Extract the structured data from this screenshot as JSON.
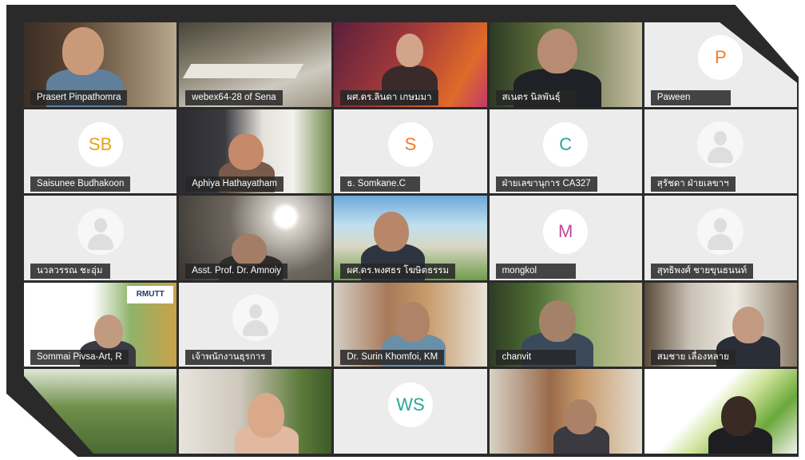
{
  "participants": [
    {
      "name": "Prasert Pinpathomra",
      "kind": "video"
    },
    {
      "name": "webex64-28 of  Sena",
      "kind": "video"
    },
    {
      "name": "ผศ.ดร.ลินดา เกษมมา",
      "kind": "video"
    },
    {
      "name": "สเนตร นิลพันธุ์",
      "kind": "video"
    },
    {
      "name": "Paween",
      "kind": "initials",
      "initials": "P",
      "color": "#f07a2a"
    },
    {
      "name": "Saisunee Budhakoon",
      "kind": "initials",
      "initials": "SB",
      "color": "#e3a514"
    },
    {
      "name": "Aphiya Hathayatham",
      "kind": "video"
    },
    {
      "name": "ธ. Somkane.C",
      "kind": "initials",
      "initials": "S",
      "color": "#f07a2a"
    },
    {
      "name": "ฝ่ายเลขานุการ CA327",
      "kind": "initials",
      "initials": "C",
      "color": "#2aa59a"
    },
    {
      "name": "สุรัชดา ฝ่ายเลขาฯ",
      "kind": "blank"
    },
    {
      "name": "นวลวรรณ ชะอุ่ม",
      "kind": "blank"
    },
    {
      "name": "Asst. Prof. Dr. Amnoiy",
      "kind": "video"
    },
    {
      "name": "ผศ.ดร.พงศธร โฆษิตธรรม",
      "kind": "video"
    },
    {
      "name": "mongkol",
      "kind": "initials",
      "initials": "M",
      "color": "#c2449b"
    },
    {
      "name": "สุทธิพงศ์ ชายขุนธนนท์",
      "kind": "blank"
    },
    {
      "name": "Sommai Pivsa-Art, R",
      "kind": "video",
      "logo": "RMUTT"
    },
    {
      "name": "เจ้าพนักงานธุรการ",
      "kind": "blank"
    },
    {
      "name": "Dr. Surin Khomfoi, KM",
      "kind": "video"
    },
    {
      "name": "chanvit",
      "kind": "video"
    },
    {
      "name": "สมชาย เลื่องหลาย",
      "kind": "video"
    },
    {
      "name": "",
      "kind": "video"
    },
    {
      "name": "",
      "kind": "video"
    },
    {
      "name": "",
      "kind": "initials",
      "initials": "WS",
      "color": "#2aa59a"
    },
    {
      "name": "",
      "kind": "video"
    },
    {
      "name": "",
      "kind": "video"
    }
  ]
}
